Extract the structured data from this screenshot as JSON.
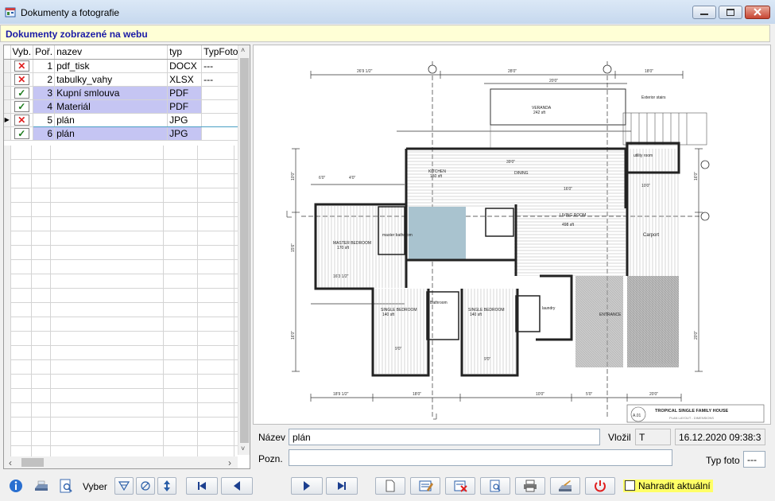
{
  "window": {
    "title": "Dokumenty a fotografie"
  },
  "header": {
    "label": "Dokumenty zobrazené na webu"
  },
  "grid": {
    "columns": [
      "Vyb.",
      "Poř.",
      "nazev",
      "typ",
      "TypFoto"
    ],
    "rows": [
      {
        "vyb": "✕",
        "poradi": "1",
        "nazev": "pdf_tisk",
        "typ": "DOCX",
        "typfoto": "---"
      },
      {
        "vyb": "✕",
        "poradi": "2",
        "nazev": "tabulky_vahy",
        "typ": "XLSX",
        "typfoto": "---"
      },
      {
        "vyb": "✓",
        "poradi": "3",
        "nazev": "Kupní smlouva",
        "typ": "PDF",
        "typfoto": ""
      },
      {
        "vyb": "✓",
        "poradi": "4",
        "nazev": "Materiál",
        "typ": "PDF",
        "typfoto": ""
      },
      {
        "vyb": "✕",
        "poradi": "5",
        "nazev": "plán",
        "typ": "JPG",
        "typfoto": ""
      },
      {
        "vyb": "✓",
        "poradi": "6",
        "nazev": "plán",
        "typ": "JPG",
        "typfoto": ""
      }
    ],
    "row_indicator": "▶",
    "scroll_left": "‹",
    "scroll_right": "›",
    "scroll_up": "˄",
    "scroll_down": "˅"
  },
  "plan": {
    "title_block": "TROPICAL SINGLE FAMILY HOUSE",
    "subtitle": "PLAN LAYOUT - DIMENSIONS",
    "sheet": "A.01",
    "rooms": {
      "kitchen": "KITCHEN",
      "kitchen_area": "150 sft",
      "dining": "DINING",
      "living": "LIVING ROOM",
      "living_area": "498 sft",
      "master": "MASTER BEDROOM",
      "master_area": "170 sft",
      "master_bath": "master bathroom",
      "single1": "SINGLE BEDROOM",
      "single1_area": "140 sft",
      "single2": "SINGLE BEDROOM",
      "single2_area": "140 sft",
      "bathroom": "Bathroom",
      "laundry": "laundry",
      "carport": "Carport",
      "veranda": "VERANDA",
      "veranda_area": "242 sft",
      "exterior": "Exterior stairs",
      "entrance": "ENTRANCE",
      "utility": "utility room"
    },
    "dims": {
      "top_left": "26'9 1/2\"",
      "top_mid": "28'0\"",
      "top_right": "18'0\"",
      "veranda_w": "20'0\"",
      "bot_left": "18'9 1/2\"",
      "bot_mid1": "18'0\"",
      "bot_mid2": "10'0\"",
      "bot_right": "20'0\"",
      "mid_row": "39'0\"",
      "living_row": "16'0\"",
      "left_h1": "10'0\"",
      "left_h2": "15'6\"",
      "left_h3": "16'0\"",
      "right_h1": "16'0\"",
      "right_h2": "20'0\"",
      "master_w": "16'3 1/2\"",
      "carport_w": "10'0\"",
      "lower_left": "9'0\"",
      "lower_mid": "9'0\"",
      "gate": "5'0\"",
      "small_w": "6'0\"",
      "bath_w": "4'0\""
    }
  },
  "form": {
    "nazev_label": "Název",
    "nazev_value": "plán",
    "vlozil_label": "Vložil",
    "vlozil_value": "T",
    "datum_value": "16.12.2020 09:38:3",
    "pozn_label": "Pozn.",
    "pozn_value": "",
    "typfoto_label": "Typ foto",
    "typfoto_value": "---"
  },
  "toolbar": {
    "vyber_label": "Vyber",
    "nahradit_label": "Nahradit aktuální"
  }
}
